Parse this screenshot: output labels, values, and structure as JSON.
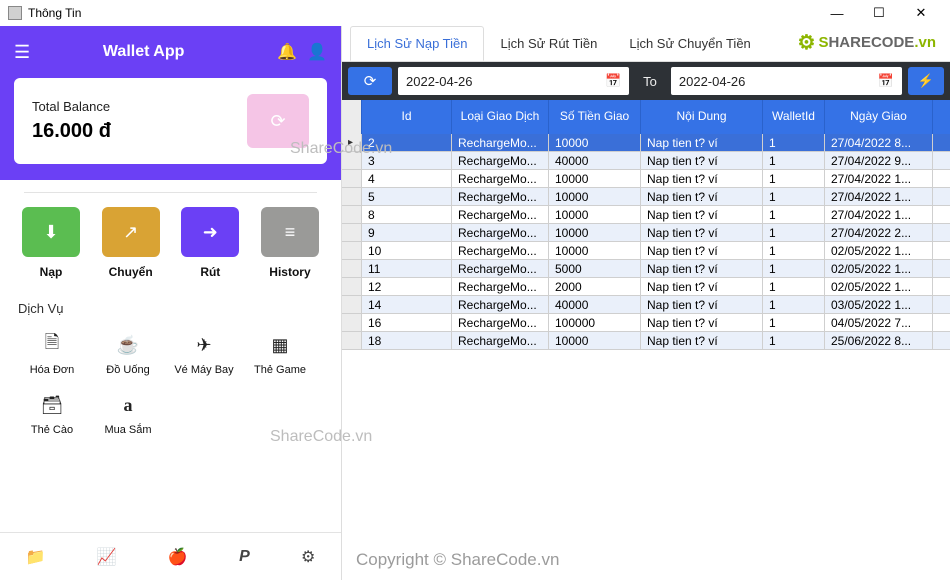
{
  "window": {
    "title": "Thông Tin"
  },
  "brand": {
    "text": "SHARECODE.vn"
  },
  "wallet": {
    "title": "Wallet App",
    "balance_label": "Total Balance",
    "balance_value": "16.000 đ",
    "actions": {
      "nap": "Nạp",
      "chuyen": "Chuyển",
      "rut": "Rút",
      "history": "History"
    },
    "services_title": "Dịch Vụ",
    "services": {
      "hoadon": "Hóa Đơn",
      "douong": "Đồ Uống",
      "vemaybay": "Vé Máy Bay",
      "thegame": "Thẻ Game",
      "thecao": "Thẻ Cào",
      "muasam": "Mua Sắm"
    }
  },
  "tabs": {
    "nap": "Lịch Sử Nạp Tiền",
    "rut": "Lịch Sử Rút Tiền",
    "chuyen": "Lịch Sử Chuyển Tiền"
  },
  "filter": {
    "date_from": "2022-04-26",
    "to_label": "To",
    "date_to": "2022-04-26"
  },
  "grid_headers": {
    "id": "Id",
    "type": "Loại Giao Dịch",
    "amount": "Số Tiền Giao",
    "desc": "Nội Dung",
    "wallet": "WalletId",
    "date": "Ngày Giao"
  },
  "rows": [
    {
      "id": "2",
      "type": "RechargeMo...",
      "amount": "10000",
      "desc": "Nap tien t? ví",
      "wallet": "1",
      "date": "27/04/2022 8..."
    },
    {
      "id": "3",
      "type": "RechargeMo...",
      "amount": "40000",
      "desc": "Nap tien t? ví",
      "wallet": "1",
      "date": "27/04/2022 9..."
    },
    {
      "id": "4",
      "type": "RechargeMo...",
      "amount": "10000",
      "desc": "Nap tien t? ví",
      "wallet": "1",
      "date": "27/04/2022 1..."
    },
    {
      "id": "5",
      "type": "RechargeMo...",
      "amount": "10000",
      "desc": "Nap tien t? ví",
      "wallet": "1",
      "date": "27/04/2022 1..."
    },
    {
      "id": "8",
      "type": "RechargeMo...",
      "amount": "10000",
      "desc": "Nap tien t? ví",
      "wallet": "1",
      "date": "27/04/2022 1..."
    },
    {
      "id": "9",
      "type": "RechargeMo...",
      "amount": "10000",
      "desc": "Nap tien t? ví",
      "wallet": "1",
      "date": "27/04/2022 2..."
    },
    {
      "id": "10",
      "type": "RechargeMo...",
      "amount": "10000",
      "desc": "Nap tien t? ví",
      "wallet": "1",
      "date": "02/05/2022 1..."
    },
    {
      "id": "11",
      "type": "RechargeMo...",
      "amount": "5000",
      "desc": "Nap tien t? ví",
      "wallet": "1",
      "date": "02/05/2022 1..."
    },
    {
      "id": "12",
      "type": "RechargeMo...",
      "amount": "2000",
      "desc": "Nap tien t? ví",
      "wallet": "1",
      "date": "02/05/2022 1..."
    },
    {
      "id": "14",
      "type": "RechargeMo...",
      "amount": "40000",
      "desc": "Nap tien t? ví",
      "wallet": "1",
      "date": "03/05/2022 1..."
    },
    {
      "id": "16",
      "type": "RechargeMo...",
      "amount": "100000",
      "desc": "Nap tien t? ví",
      "wallet": "1",
      "date": "04/05/2022 7..."
    },
    {
      "id": "18",
      "type": "RechargeMo...",
      "amount": "10000",
      "desc": "Nap tien t? ví",
      "wallet": "1",
      "date": "25/06/2022 8..."
    }
  ],
  "watermarks": {
    "wm": "ShareCode.vn",
    "copyright": "Copyright © ShareCode.vn"
  }
}
